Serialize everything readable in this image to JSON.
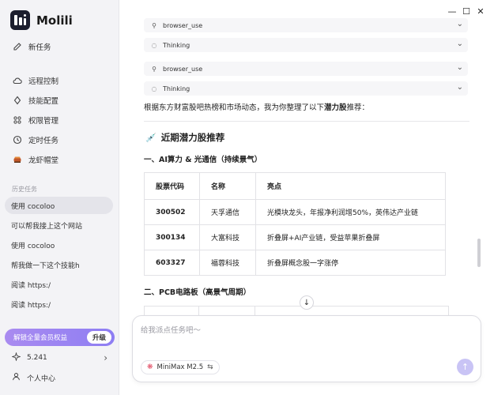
{
  "app": {
    "name": "Molili"
  },
  "sidebar": {
    "new_task": "新任务",
    "nav": [
      {
        "label": "远程控制",
        "icon": "cloud-icon"
      },
      {
        "label": "技能配置",
        "icon": "diamond-icon"
      },
      {
        "label": "权限管理",
        "icon": "grid-icon"
      },
      {
        "label": "定时任务",
        "icon": "clock-icon"
      },
      {
        "label": "龙虾帽堂",
        "icon": "lobster-icon"
      }
    ],
    "history_label": "历史任务",
    "history": [
      "使用 cocoloo",
      "可以帮我接上这个网站",
      "使用 cocoloo",
      "帮我做一下这个技能h",
      "阅读 https:/",
      "阅读 https:/"
    ],
    "vip_label": "解锁全量会员权益",
    "upgrade_label": "升级",
    "points": "5.241",
    "profile": "个人中心"
  },
  "window": {
    "minimize": "—",
    "maximize": "☐",
    "close": "✕"
  },
  "tools": [
    {
      "label": "browser_use",
      "icon": "key-icon"
    },
    {
      "label": "Thinking",
      "icon": "bulb-icon"
    },
    {
      "label": "browser_use",
      "icon": "key-icon"
    },
    {
      "label": "Thinking",
      "icon": "bulb-icon"
    }
  ],
  "message": {
    "intro_prefix": "根据东方财富股吧热榜和市场动态，我为你整理了以下",
    "intro_bold": "潜力股",
    "intro_suffix": "推荐：",
    "heading": "近期潜力股推荐",
    "section1": "一、AI算力 & 光通信（持续景气）",
    "table": {
      "headers": [
        "股票代码",
        "名称",
        "亮点"
      ],
      "rows": [
        [
          "300502",
          "天孚通信",
          "光模块龙头，年报净利润增50%，英伟达产业链"
        ],
        [
          "300134",
          "大富科技",
          "折叠屏+AI产业链，受益苹果折叠屏"
        ],
        [
          "603327",
          "福蓉科技",
          "折叠屏概念股一字涨停"
        ]
      ]
    },
    "section2": "二、PCB电路板（高景气周期）"
  },
  "composer": {
    "placeholder": "给我派点任务吧～",
    "model": "MiniMax M2.5"
  }
}
